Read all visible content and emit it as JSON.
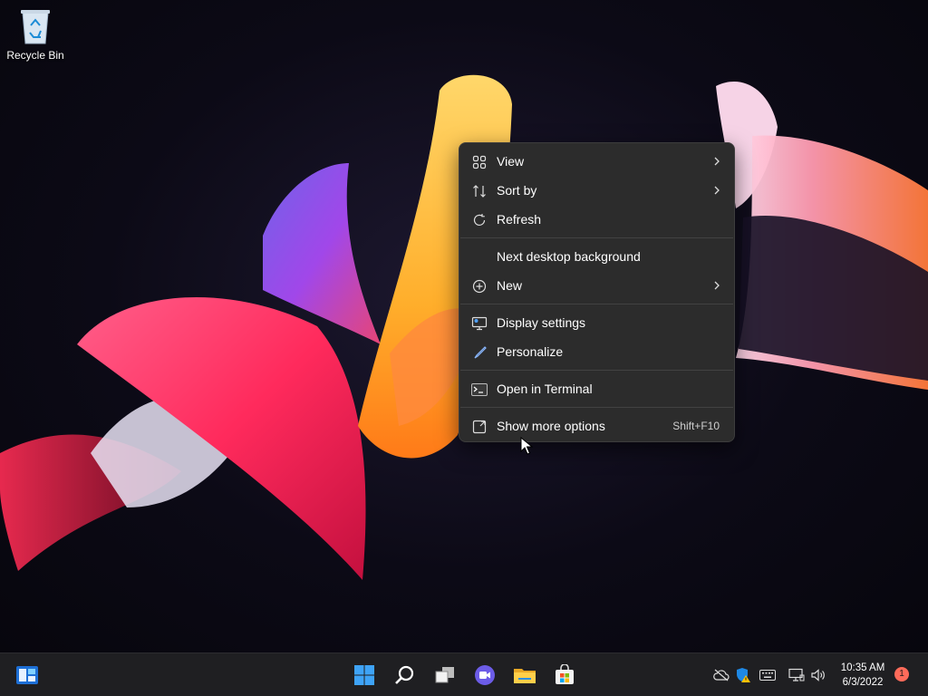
{
  "desktop": {
    "icons": [
      {
        "label": "Recycle Bin",
        "icon": "recycle-bin-icon"
      }
    ]
  },
  "context_menu": {
    "items": [
      {
        "label": "View",
        "icon": "view-grid-icon",
        "submenu": true
      },
      {
        "label": "Sort by",
        "icon": "sort-icon",
        "submenu": true
      },
      {
        "label": "Refresh",
        "icon": "refresh-icon",
        "submenu": false
      },
      {
        "label": "Next desktop background",
        "icon": "",
        "submenu": false
      },
      {
        "label": "New",
        "icon": "new-plus-icon",
        "submenu": true
      },
      {
        "label": "Display settings",
        "icon": "display-settings-icon",
        "submenu": false
      },
      {
        "label": "Personalize",
        "icon": "brush-icon",
        "submenu": false
      },
      {
        "label": "Open in Terminal",
        "icon": "terminal-icon",
        "submenu": false
      },
      {
        "label": "Show more options",
        "icon": "show-more-icon",
        "shortcut": "Shift+F10"
      }
    ]
  },
  "taskbar": {
    "apps": [
      "widgets-icon",
      "start-icon",
      "search-icon",
      "task-view-icon",
      "chat-icon",
      "file-explorer-icon",
      "store-icon"
    ],
    "tray": [
      "network-off-icon",
      "security-warning-icon",
      "keyboard-icon",
      "display-icon",
      "volume-icon"
    ],
    "clock": {
      "time": "10:35 AM",
      "date": "6/3/2022"
    },
    "notification_count": "1"
  },
  "colors": {
    "menu_bg": "#2c2c2c",
    "taskbar_bg": "#1f1f22",
    "accent": "#0078d4",
    "badge": "#ff6b5a"
  }
}
